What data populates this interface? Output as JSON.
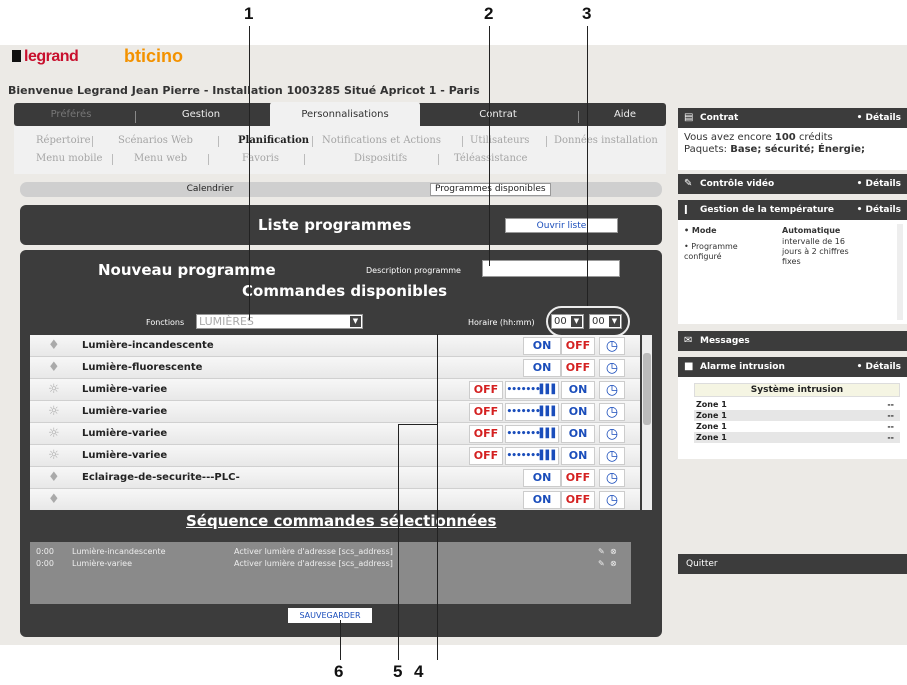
{
  "callouts": [
    "1",
    "2",
    "3",
    "6",
    "5",
    "4"
  ],
  "branding": {
    "legrand": "legrand",
    "bticino": "bticino"
  },
  "welcome": "Bienvenue Legrand Jean Pierre - Installation 1003285 Situé Apricot 1 - Paris",
  "tabs": [
    "Préférés",
    "Gestion",
    "Personnalisations",
    "Contrat",
    "Aide"
  ],
  "submenu_row1": [
    "Répertoire",
    "Scénarios Web",
    "Planification",
    "Notifications et Actions",
    "Utilisateurs",
    "Données installation"
  ],
  "submenu_row2": [
    "Menu mobile",
    "Menu web",
    "Favoris",
    "Dispositifs",
    "Téléassistance"
  ],
  "subtabs": [
    "Calendrier",
    "Programmes disponibles"
  ],
  "liste": {
    "title": "Liste programmes",
    "open_button": "Ouvrir liste"
  },
  "new_program": {
    "title": "Nouveau programme",
    "description_label": "Description programme",
    "description_value": "",
    "commands_title": "Commandes disponibles",
    "functions_label": "Fonctions",
    "functions_value": "LUMIÈRES",
    "schedule_label": "Horaire (hh:mm)",
    "hour": "00",
    "minute": "00"
  },
  "commands": [
    {
      "label": "Lumière-incandescente",
      "buttons": [
        "ON",
        "OFF"
      ]
    },
    {
      "label": "Lumière-fluorescente",
      "buttons": [
        "ON",
        "OFF"
      ]
    },
    {
      "label": "Lumière-variee",
      "buttons": [
        "OFF",
        "dim",
        "ON"
      ]
    },
    {
      "label": "Lumière-variee",
      "buttons": [
        "OFF",
        "dim",
        "ON"
      ]
    },
    {
      "label": "Lumière-variee",
      "buttons": [
        "OFF",
        "dim",
        "ON"
      ]
    },
    {
      "label": "Lumière-variee",
      "buttons": [
        "OFF",
        "dim",
        "ON"
      ]
    },
    {
      "label": "Eclairage-de-securite---PLC-",
      "buttons": [
        "ON",
        "OFF"
      ]
    },
    {
      "label": "",
      "buttons": [
        "ON",
        "OFF"
      ]
    }
  ],
  "sequence": {
    "title": "Séquence commandes sélectionnées",
    "rows": [
      {
        "time": "0:00",
        "device": "Lumière-incandescente",
        "action": "Activer lumière d'adresse [scs_address]"
      },
      {
        "time": "0:00",
        "device": "Lumière-variee",
        "action": "Activer lumière d'adresse [scs_address]"
      }
    ],
    "save_button": "SAUVEGARDER"
  },
  "right": {
    "contrat": {
      "title": "Contrat",
      "details": "• Détails",
      "line1_prefix": "Vous avez encore",
      "credits": "100",
      "line1_suffix": "crédits",
      "packages_label": "Paquets:",
      "packages": "Base; sécurité; Énergie;"
    },
    "video": {
      "title": "Contrôle vidéo",
      "details": "• Détails"
    },
    "temperature": {
      "title": "Gestion de la température",
      "details": "• Détails",
      "mode_label": "• Mode",
      "mode_value": "Automatique",
      "prog_label": "• Programme configuré",
      "prog_value": "intervalle de 16 jours à 2 chiffres fixes"
    },
    "messages": {
      "title": "Messages"
    },
    "alarme": {
      "title": "Alarme intrusion",
      "details": "• Détails",
      "system": "Système intrusion",
      "zones": [
        {
          "name": "Zone 1",
          "value": "--"
        },
        {
          "name": "Zone 1",
          "value": "--"
        },
        {
          "name": "Zone 1",
          "value": "--"
        },
        {
          "name": "Zone 1",
          "value": "--"
        }
      ]
    },
    "quitter": "Quitter"
  }
}
